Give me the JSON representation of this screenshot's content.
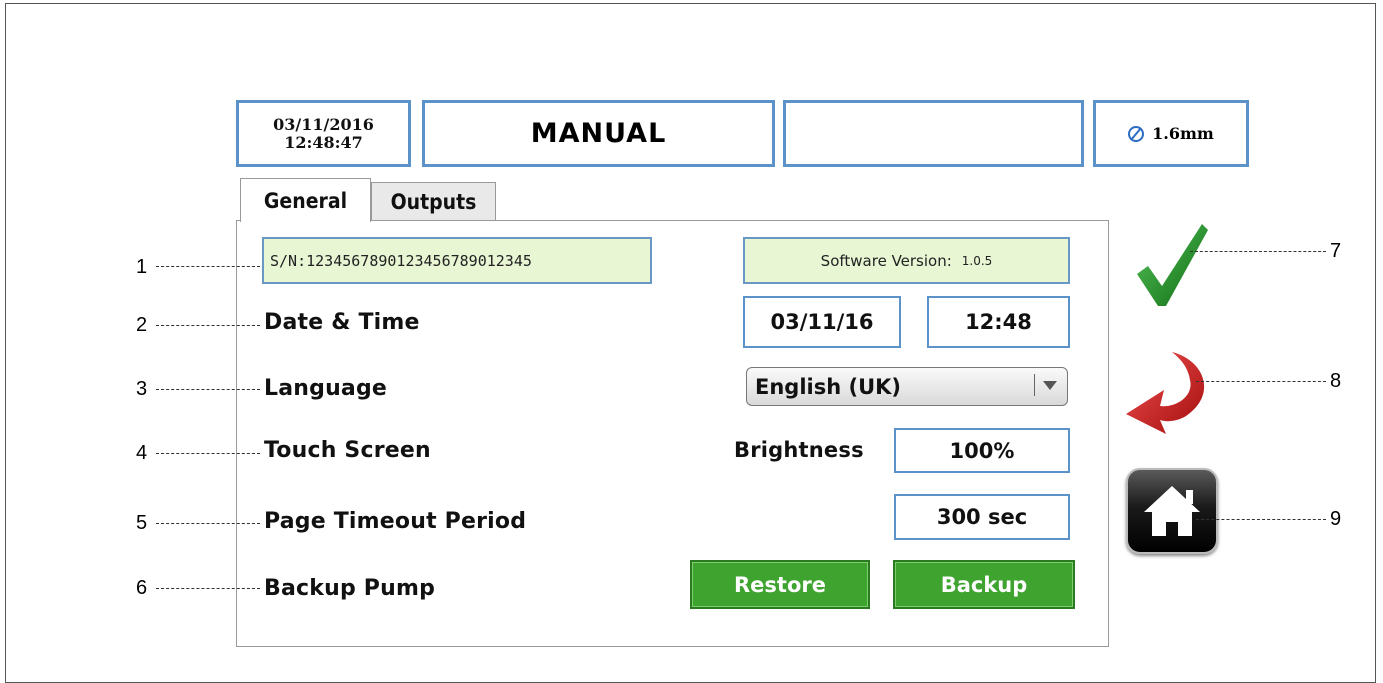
{
  "header": {
    "date": "03/11/2016",
    "time": "12:48:47",
    "mode": "MANUAL",
    "status": "",
    "nozzle_icon": "diameter-icon",
    "nozzle_size": "1.6mm"
  },
  "tabs": [
    {
      "label": "General",
      "active": true
    },
    {
      "label": "Outputs",
      "active": false
    }
  ],
  "general": {
    "serial": "S/N:1234567890123456789012345",
    "software_version_label": "Software Version:",
    "software_version": "1.0.5",
    "date_time_label": "Date & Time",
    "date_value": "03/11/16",
    "time_value": "12:48",
    "language_label": "Language",
    "language_value": "English (UK)",
    "touch_screen_label": "Touch Screen",
    "brightness_label": "Brightness",
    "brightness_value": "100%",
    "timeout_label": "Page Timeout Period",
    "timeout_value": "300 sec",
    "backup_pump_label": "Backup Pump",
    "restore_label": "Restore",
    "backup_label": "Backup"
  },
  "side_buttons": {
    "confirm_icon": "checkmark-icon",
    "back_icon": "back-arrow-icon",
    "home_icon": "home-icon"
  },
  "callouts": [
    "1",
    "2",
    "3",
    "4",
    "5",
    "6",
    "7",
    "8",
    "9"
  ],
  "colors": {
    "box_border": "#5b93c9",
    "info_fill": "#e8f6d4",
    "button_green": "#3ea32f",
    "check_green": "#1f8a1f",
    "back_red": "#d62020"
  }
}
